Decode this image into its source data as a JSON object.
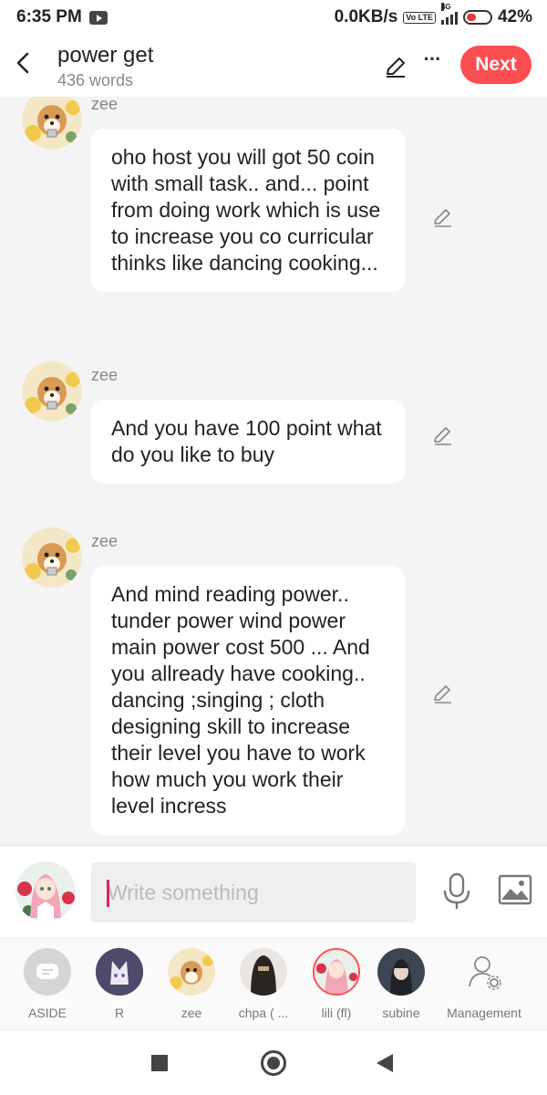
{
  "status": {
    "time": "6:35 PM",
    "speed": "0.0KB/s",
    "network": "4G",
    "volte": "Vo LTE",
    "battery": "42%"
  },
  "header": {
    "title": "power get",
    "subtitle": "436 words",
    "next_label": "Next"
  },
  "messages": [
    {
      "name": "zee",
      "text": "oho host you will got 50 coin with small task.. and... point from doing work which is use to increase you co curricular thinks like dancing cooking..."
    },
    {
      "name": "zee",
      "text": "And you have 100 point what do you like to buy"
    },
    {
      "name": "zee",
      "text": "And mind reading power.. tunder power wind power main power cost 500 ... And you allready have cooking.. dancing ;singing ; cloth designing skill to increase their level you have to work how much you work their level incress"
    }
  ],
  "composer": {
    "placeholder": "Write something"
  },
  "characters": [
    {
      "label": "ASIDE"
    },
    {
      "label": "R"
    },
    {
      "label": "zee"
    },
    {
      "label": "chpa ( ..."
    },
    {
      "label": "lili (fl)"
    },
    {
      "label": "subine"
    },
    {
      "label": "Management"
    }
  ],
  "colors": {
    "accent": "#fb4e52",
    "background": "#f4f4f4",
    "bubble": "#ffffff"
  }
}
